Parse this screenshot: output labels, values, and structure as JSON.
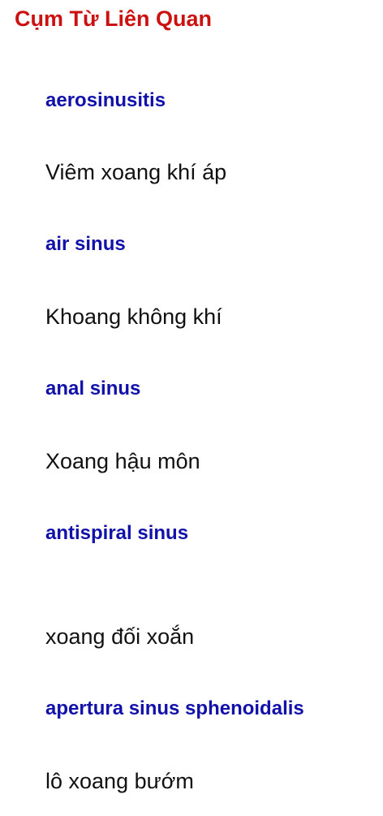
{
  "section": {
    "title": "Cụm Từ Liên Quan"
  },
  "phrases": [
    {
      "term": "aerosinusitis",
      "meaning": "Viêm xoang khí áp"
    },
    {
      "term": "air sinus",
      "meaning": "Khoang không khí"
    },
    {
      "term": "anal sinus",
      "meaning": "Xoang hậu môn"
    },
    {
      "term": "antispiral sinus",
      "meaning": "xoang đối xoắn"
    },
    {
      "term": "apertura sinus sphenoidalis",
      "meaning": "lô xoang bướm"
    }
  ],
  "colors": {
    "title": "#cc1111",
    "term": "#1111aa",
    "meaning": "#111111",
    "background": "#ffffff"
  }
}
